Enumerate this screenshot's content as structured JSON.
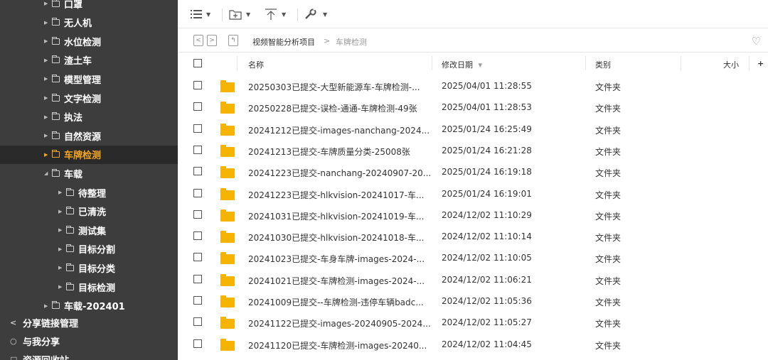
{
  "sidebar": {
    "tree": [
      {
        "label": "口罩",
        "expanded": false,
        "selected": false
      },
      {
        "label": "无人机",
        "expanded": false,
        "selected": false
      },
      {
        "label": "水位检测",
        "expanded": false,
        "selected": false
      },
      {
        "label": "渣土车",
        "expanded": false,
        "selected": false
      },
      {
        "label": "模型管理",
        "expanded": false,
        "selected": false
      },
      {
        "label": "文字检测",
        "expanded": false,
        "selected": false
      },
      {
        "label": "执法",
        "expanded": false,
        "selected": false
      },
      {
        "label": "自然资源",
        "expanded": false,
        "selected": false
      },
      {
        "label": "车牌检测",
        "expanded": false,
        "selected": true
      },
      {
        "label": "车载",
        "expanded": true,
        "selected": false
      },
      {
        "label": "待整理",
        "expanded": false,
        "selected": false
      },
      {
        "label": "已清洗",
        "expanded": false,
        "selected": false
      },
      {
        "label": "测试集",
        "expanded": false,
        "selected": false
      },
      {
        "label": "目标分割",
        "expanded": false,
        "selected": false
      },
      {
        "label": "目标分类",
        "expanded": false,
        "selected": false
      },
      {
        "label": "目标检测",
        "expanded": false,
        "selected": false
      },
      {
        "label": "车载-202401",
        "expanded": false,
        "selected": false
      }
    ],
    "sections": [
      {
        "label": "分享链接管理",
        "icon": "share-icon",
        "glyph": "<"
      },
      {
        "label": "与我分享",
        "icon": "shared-with-me-icon",
        "glyph": "○"
      },
      {
        "label": "资源回收站",
        "icon": "recycle-bin-icon",
        "glyph": "□"
      }
    ]
  },
  "toolbar": {
    "view_icon": "list-view-icon",
    "new_folder_icon": "new-folder-icon",
    "upload_icon": "upload-icon",
    "tools_icon": "wrench-icon"
  },
  "breadcrumb": {
    "items": [
      "视频智能分析项目",
      "车牌检测"
    ],
    "separator": ">"
  },
  "table": {
    "columns": {
      "name": "名称",
      "date": "修改日期",
      "date_sort": "▾",
      "type": "类别",
      "size": "大小",
      "add": "+"
    },
    "rows": [
      {
        "name": "20250303已提交-大型新能源车-车牌检测-...",
        "date": "2025/04/01 11:28:55",
        "type": "文件夹"
      },
      {
        "name": "20250228已提交-误检-通通-车牌检测-49张",
        "date": "2025/04/01 11:28:53",
        "type": "文件夹"
      },
      {
        "name": "20241212已提交-images-nanchang-2024...",
        "date": "2025/01/24 16:25:49",
        "type": "文件夹"
      },
      {
        "name": "20241213已提交-车牌质量分类-25008张",
        "date": "2025/01/24 16:21:28",
        "type": "文件夹"
      },
      {
        "name": "20241223已提交-nanchang-20240907-20...",
        "date": "2025/01/24 16:19:18",
        "type": "文件夹"
      },
      {
        "name": "20241223已提交-hlkvision-20241017-车...",
        "date": "2025/01/24 16:19:01",
        "type": "文件夹"
      },
      {
        "name": "20241031已提交-hlkvision-20241019-车...",
        "date": "2024/12/02 11:10:29",
        "type": "文件夹"
      },
      {
        "name": "20241030已提交-hlkvision-20241018-车...",
        "date": "2024/12/02 11:10:14",
        "type": "文件夹"
      },
      {
        "name": "20241023已提交-车身车牌-images-2024-...",
        "date": "2024/12/02 11:10:05",
        "type": "文件夹"
      },
      {
        "name": "20241021已提交-车牌检测-images-2024-...",
        "date": "2024/12/02 11:06:21",
        "type": "文件夹"
      },
      {
        "name": "20241009已提交--车牌检测-违停车辆badc...",
        "date": "2024/12/02 11:05:36",
        "type": "文件夹"
      },
      {
        "name": "20241122已提交-images-20240905-2024...",
        "date": "2024/12/02 11:05:27",
        "type": "文件夹"
      },
      {
        "name": "20241120已提交-车牌检测-images-20240...",
        "date": "2024/12/02 11:04:45",
        "type": "文件夹"
      }
    ]
  },
  "colors": {
    "sidebar_bg": "#3d3d3d",
    "selected_text": "#f5a623",
    "folder": "#f5b400"
  }
}
